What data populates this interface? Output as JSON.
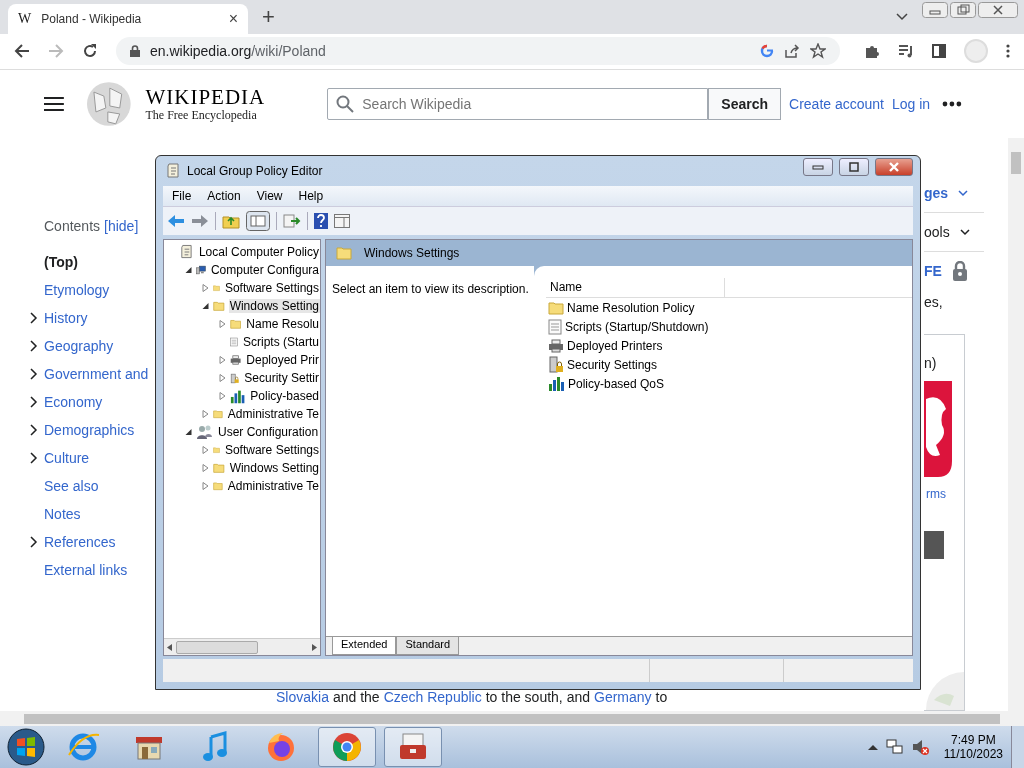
{
  "browser": {
    "tab": {
      "favicon": "W",
      "title": "Poland - Wikipedia",
      "close": "×"
    },
    "new_tab": "+",
    "url_host": "en.wikipedia.org",
    "url_path": "/wiki/Poland"
  },
  "wiki": {
    "wordmark": "WIKIPEDIA",
    "tagline": "The Free Encyclopedia",
    "search": {
      "placeholder": "Search Wikipedia",
      "button": "Search"
    },
    "links": [
      "Create account",
      "Log in"
    ],
    "toc": {
      "title": "Contents",
      "toggle": "[hide]",
      "items": [
        {
          "label": "(Top)",
          "expandable": false,
          "selected": true
        },
        {
          "label": "Etymology",
          "expandable": false,
          "selected": false
        },
        {
          "label": "History",
          "expandable": true,
          "selected": false
        },
        {
          "label": "Geography",
          "expandable": true,
          "selected": false
        },
        {
          "label": "Government and",
          "expandable": true,
          "selected": false
        },
        {
          "label": "Economy",
          "expandable": true,
          "selected": false
        },
        {
          "label": "Demographics",
          "expandable": true,
          "selected": false
        },
        {
          "label": "Culture",
          "expandable": true,
          "selected": false
        },
        {
          "label": "See also",
          "expandable": false,
          "selected": false
        },
        {
          "label": "Notes",
          "expandable": false,
          "selected": false
        },
        {
          "label": "References",
          "expandable": true,
          "selected": false
        },
        {
          "label": "External links",
          "expandable": false,
          "selected": false
        }
      ]
    },
    "side_fragments": {
      "languages": "ges",
      "tools": "ools",
      "protection": "FE",
      "text": "es,",
      "infobox_caption": "n)",
      "arms_link": "rms"
    },
    "body_line": [
      {
        "text": "Slovakia",
        "link": true
      },
      {
        "text": "and the",
        "link": false
      },
      {
        "text": "Czech Republic",
        "link": true
      },
      {
        "text": "to the south, and",
        "link": false
      },
      {
        "text": "Germany",
        "link": true
      },
      {
        "text": "to",
        "link": false
      }
    ]
  },
  "dialog": {
    "title": "Local Group Policy Editor",
    "menu": [
      "File",
      "Action",
      "View",
      "Help"
    ],
    "tree": [
      {
        "label": "Local Computer Policy",
        "kind": "policy",
        "selected": false,
        "children": [
          {
            "label": "Computer Configura",
            "kind": "computer",
            "expandable": true,
            "expanded": true,
            "selected": false,
            "children": [
              {
                "label": "Software Settings",
                "kind": "folder",
                "expandable": true,
                "expanded": false,
                "selected": false
              },
              {
                "label": "Windows Setting",
                "kind": "folder",
                "expandable": true,
                "expanded": true,
                "selected": true,
                "children": [
                  {
                    "label": "Name Resolu",
                    "kind": "folder",
                    "expandable": true,
                    "expanded": false,
                    "selected": false
                  },
                  {
                    "label": "Scripts (Startu",
                    "kind": "script",
                    "selected": false
                  },
                  {
                    "label": "Deployed Prir",
                    "kind": "printer",
                    "expandable": true,
                    "expanded": false,
                    "selected": false
                  },
                  {
                    "label": "Security Settir",
                    "kind": "security",
                    "expandable": true,
                    "expanded": false,
                    "selected": false
                  },
                  {
                    "label": "Policy-based",
                    "kind": "qos",
                    "expandable": true,
                    "expanded": false,
                    "selected": false
                  }
                ]
              },
              {
                "label": "Administrative Te",
                "kind": "folder",
                "expandable": true,
                "expanded": false,
                "selected": false
              }
            ]
          },
          {
            "label": "User Configuration",
            "kind": "user",
            "expandable": true,
            "expanded": true,
            "selected": false,
            "children": [
              {
                "label": "Software Settings",
                "kind": "folder",
                "expandable": true,
                "expanded": false,
                "selected": false
              },
              {
                "label": "Windows Setting",
                "kind": "folder",
                "expandable": true,
                "expanded": false,
                "selected": false
              },
              {
                "label": "Administrative Te",
                "kind": "folder",
                "expandable": true,
                "expanded": false,
                "selected": false
              }
            ]
          }
        ]
      }
    ],
    "header": "Windows Settings",
    "description": "Select an item to view its description.",
    "column": "Name",
    "items": [
      {
        "label": "Name Resolution Policy",
        "kind": "folder"
      },
      {
        "label": "Scripts (Startup/Shutdown)",
        "kind": "script"
      },
      {
        "label": "Deployed Printers",
        "kind": "printer"
      },
      {
        "label": "Security Settings",
        "kind": "security"
      },
      {
        "label": "Policy-based QoS",
        "kind": "qos"
      }
    ],
    "tabs": [
      {
        "label": "Extended",
        "selected": true
      },
      {
        "label": "Standard",
        "selected": false
      }
    ]
  },
  "taskbar": {
    "apps": [
      {
        "kind": "ie",
        "active": false
      },
      {
        "kind": "store",
        "active": false
      },
      {
        "kind": "music",
        "active": false
      },
      {
        "kind": "firefox",
        "active": false
      },
      {
        "kind": "chrome",
        "active": true
      },
      {
        "kind": "toolbox",
        "active": true
      }
    ],
    "time": "7:49 PM",
    "date": "11/10/2023"
  }
}
